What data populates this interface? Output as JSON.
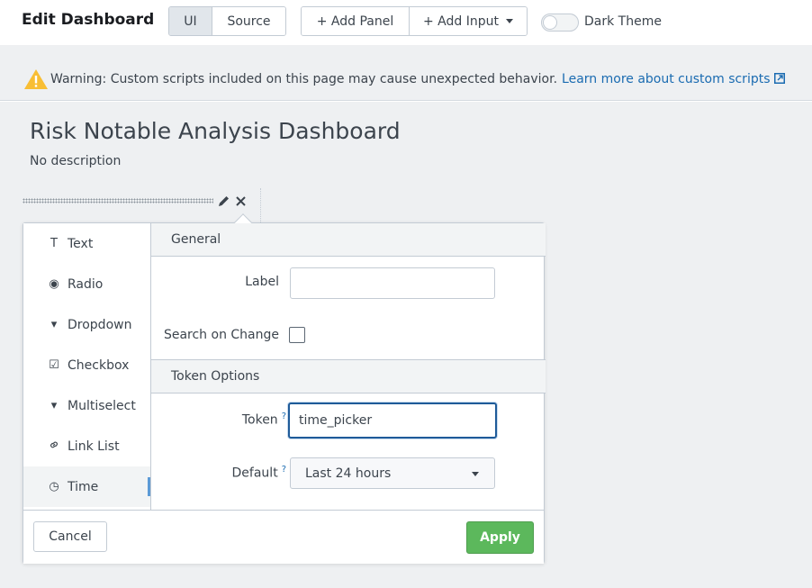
{
  "topbar": {
    "title": "Edit Dashboard",
    "view_tabs": [
      {
        "label": "UI",
        "active": true
      },
      {
        "label": "Source",
        "active": false
      }
    ],
    "add_panel_label": "+ Add Panel",
    "add_input_label": "+ Add Input",
    "dark_theme_label": "Dark Theme",
    "dark_theme_on": false
  },
  "warning": {
    "icon": "warning-triangle-icon",
    "text": "Warning: Custom scripts included on this page may cause unexpected behavior.",
    "link_text": "Learn more about custom scripts",
    "color": "#f8be34"
  },
  "dashboard": {
    "title": "Risk Notable Analysis Dashboard",
    "description": "No description"
  },
  "input_editor": {
    "types": [
      {
        "label": "Text",
        "icon": "T",
        "active": false
      },
      {
        "label": "Radio",
        "icon": "◉",
        "active": false
      },
      {
        "label": "Dropdown",
        "icon": "▾",
        "active": false
      },
      {
        "label": "Checkbox",
        "icon": "☑",
        "active": false
      },
      {
        "label": "Multiselect",
        "icon": "▾",
        "active": false
      },
      {
        "label": "Link List",
        "icon": "🔗",
        "active": false
      },
      {
        "label": "Time",
        "icon": "◷",
        "active": true
      }
    ],
    "general_header": "General",
    "label_label": "Label",
    "label_value": "",
    "search_on_change_label": "Search on Change",
    "search_on_change_checked": false,
    "token_options_header": "Token Options",
    "token_label": "Token",
    "token_help": "?",
    "token_value": "time_picker",
    "default_label": "Default",
    "default_help": "?",
    "default_value": "Last 24 hours",
    "cancel_label": "Cancel",
    "apply_label": "Apply"
  },
  "colors": {
    "accent_link": "#1a6bb1",
    "apply_green": "#5cb85c",
    "focus_blue": "#1f5b99",
    "active_indicator": "#5c9ad6"
  }
}
